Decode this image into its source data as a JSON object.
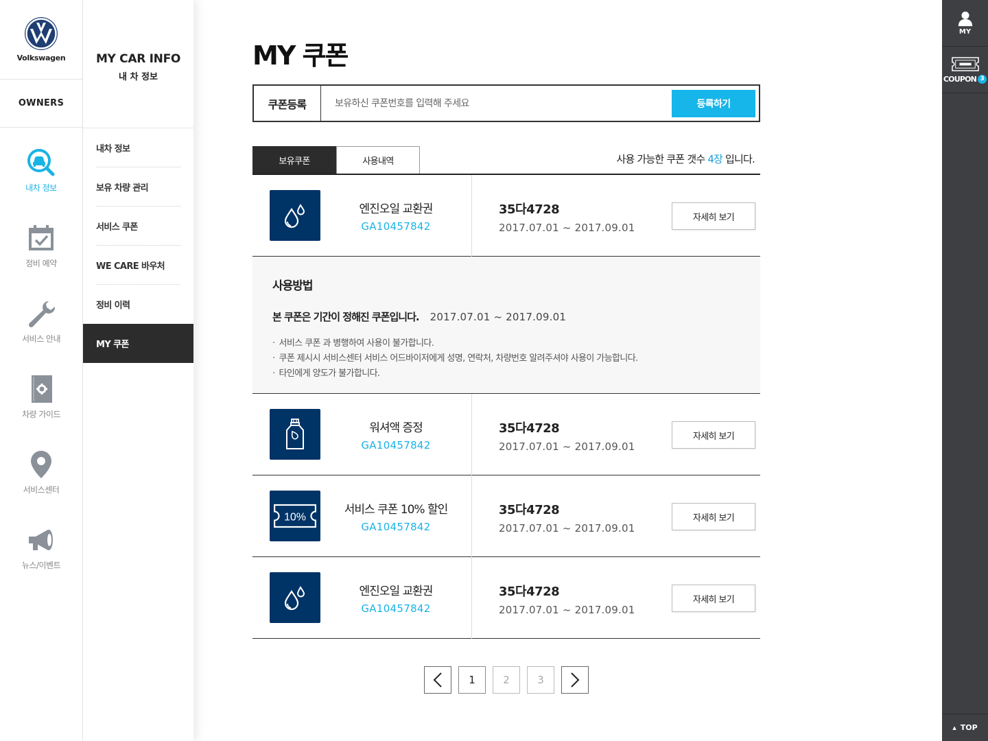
{
  "brand": {
    "name": "Volkswagen"
  },
  "left_nav": {
    "owners_label": "OWNERS",
    "items": [
      {
        "label": "내차 정보",
        "icon": "car-search-icon",
        "active": true
      },
      {
        "label": "정비 예약",
        "icon": "calendar-check-icon",
        "active": false
      },
      {
        "label": "서비스 안내",
        "icon": "wrench-icon",
        "active": false
      },
      {
        "label": "차량 가이드",
        "icon": "guide-book-icon",
        "active": false
      },
      {
        "label": "서비스센터",
        "icon": "location-pin-icon",
        "active": false
      },
      {
        "label": "뉴스/이벤트",
        "icon": "megaphone-icon",
        "active": false
      }
    ]
  },
  "sub_menu": {
    "title_en": "MY CAR INFO",
    "title_ko": "내 차 정보",
    "items": [
      {
        "label": "내차 정보"
      },
      {
        "label": "보유 차량 관리"
      },
      {
        "label": "서비스 쿠폰"
      },
      {
        "label": "WE CARE 바우처"
      },
      {
        "label": "정비 이력"
      },
      {
        "label": "MY 쿠폰"
      }
    ]
  },
  "right_bar": {
    "my_label": "MY",
    "coupon_label": "COUPON",
    "coupon_count": "3",
    "top_label": "TOP"
  },
  "page": {
    "title": "MY 쿠폰"
  },
  "register": {
    "label": "쿠폰등록",
    "placeholder": "보유하신 쿠폰번호를 입력해 주세요",
    "button": "등록하기"
  },
  "tabs": [
    {
      "label": "보유쿠폰"
    },
    {
      "label": "사용내역"
    }
  ],
  "count_text": {
    "prefix": "사용 가능한 쿠폰 갯수 ",
    "count": "4장",
    "suffix": " 입니다."
  },
  "coupons": [
    {
      "icon": "oil-drop-icon",
      "name": "엔진오일 교환권",
      "code": "GA10457842",
      "plate": "35다4728",
      "period": "2017.07.01 ~ 2017.09.01",
      "button": "자세히 보기"
    },
    {
      "icon": "washer-fluid-icon",
      "name": "워셔액 증정",
      "code": "GA10457842",
      "plate": "35다4728",
      "period": "2017.07.01 ~ 2017.09.01",
      "button": "자세히 보기"
    },
    {
      "icon": "discount-ticket-icon",
      "icon_text": "10%",
      "name": "서비스 쿠폰 10% 할인",
      "code": "GA10457842",
      "plate": "35다4728",
      "period": "2017.07.01 ~ 2017.09.01",
      "button": "자세히 보기"
    },
    {
      "icon": "oil-drop-icon",
      "name": "엔진오일 교환권",
      "code": "GA10457842",
      "plate": "35다4728",
      "period": "2017.07.01 ~ 2017.09.01",
      "button": "자세히 보기"
    }
  ],
  "usage": {
    "title": "사용방법",
    "lead": "본 쿠폰은 기간이 정해진 쿠폰입니다.",
    "dates": "2017.07.01 ~ 2017.09.01",
    "notes": [
      "서비스 쿠폰 과 병행하여 사용이 불가합니다.",
      "쿠폰 제시시 서비스센터 서비스 어드바이저에게 성명, 연락처, 차량번호 알려주셔야 사용이 가능합니다.",
      "타인에게 양도가 불가합니다."
    ]
  },
  "pagination": {
    "pages": [
      "1",
      "2",
      "3"
    ],
    "current": "1"
  },
  "colors": {
    "accent": "#1ab3e6",
    "icon_bg": "#003366",
    "dark": "#2c2c2c",
    "right_bar": "#3d3f42"
  }
}
